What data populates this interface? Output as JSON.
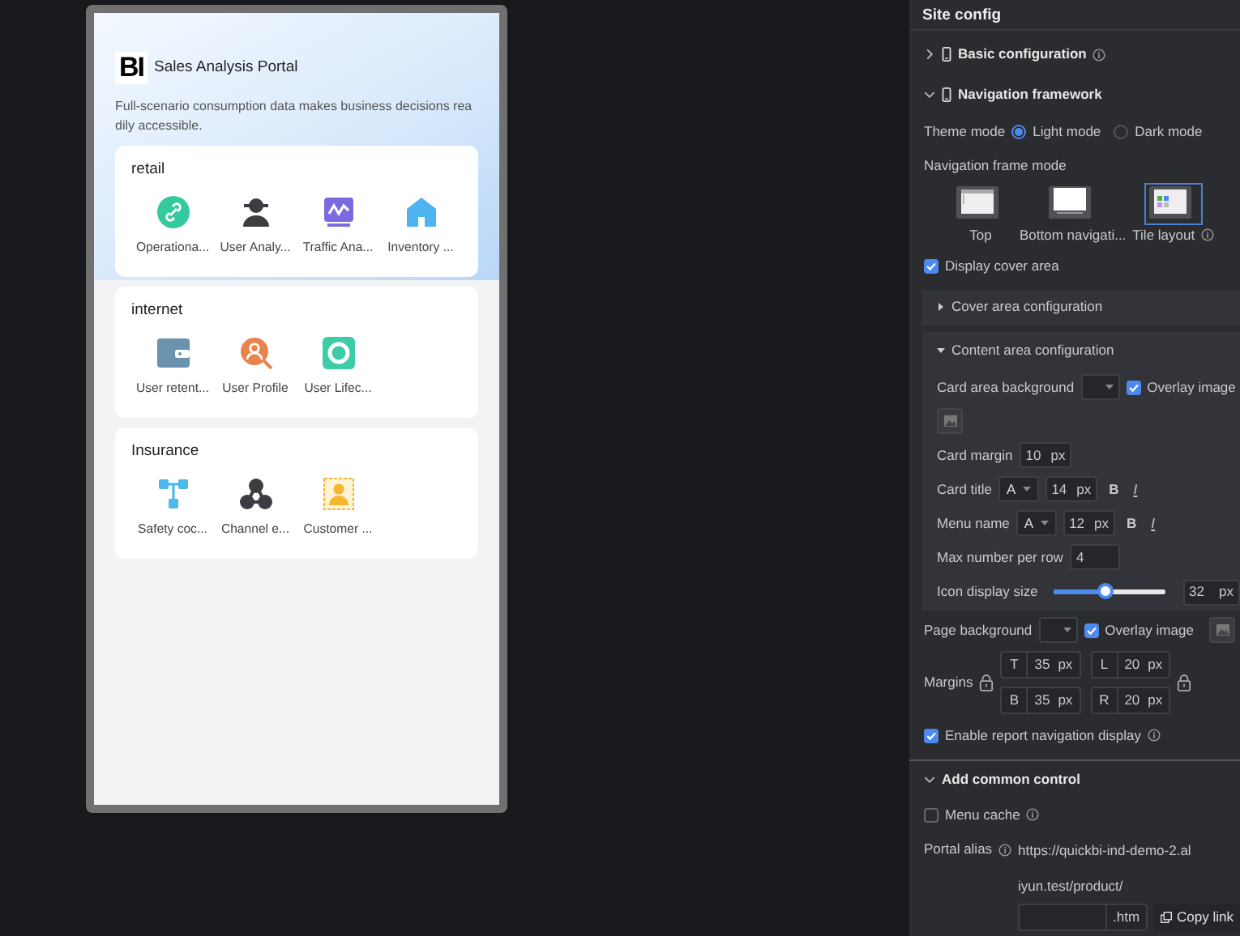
{
  "preview": {
    "logo": "BI",
    "title": "Sales Analysis Portal",
    "description": "Full-scenario consumption data makes business decisions readily accessible.",
    "groups": [
      {
        "title": "retail",
        "items": [
          {
            "label": "Operationa...",
            "kind": "link",
            "color": "#35c9a0"
          },
          {
            "label": "User Analy...",
            "kind": "user",
            "color": "#3b3d42"
          },
          {
            "label": "Traffic Ana...",
            "kind": "chart",
            "color": "#7b6be0"
          },
          {
            "label": "Inventory ...",
            "kind": "house",
            "color": "#4fb3f0"
          }
        ]
      },
      {
        "title": "internet",
        "items": [
          {
            "label": "User retent...",
            "kind": "wallet",
            "color": "#6b93ad"
          },
          {
            "label": "User Profile",
            "kind": "usersearch",
            "color": "#e8834e"
          },
          {
            "label": "User Lifec...",
            "kind": "ring",
            "color": "#3ecba8"
          }
        ]
      },
      {
        "title": "Insurance",
        "items": [
          {
            "label": "Safety coc...",
            "kind": "network",
            "color": "#4fb8ea"
          },
          {
            "label": "Channel e...",
            "kind": "nodes",
            "color": "#3b3d42"
          },
          {
            "label": "Customer ...",
            "kind": "contact",
            "color": "#f5b731"
          }
        ]
      }
    ]
  },
  "panel": {
    "title": "Site config",
    "basic": {
      "label": "Basic configuration",
      "expanded": false
    },
    "nav": {
      "label": "Navigation framework",
      "expanded": true,
      "theme": {
        "label": "Theme mode",
        "options": [
          {
            "label": "Light mode",
            "selected": true
          },
          {
            "label": "Dark mode",
            "selected": false
          }
        ]
      },
      "frame": {
        "label": "Navigation frame mode",
        "options": [
          {
            "label": "Top",
            "kind": "top",
            "selected": false
          },
          {
            "label": "Bottom navigati...",
            "kind": "bottom",
            "selected": false
          },
          {
            "label": "Tile layout",
            "kind": "tile",
            "selected": true
          }
        ]
      },
      "cover": {
        "label": "Display cover area",
        "checked": true
      },
      "cover_config": {
        "label": "Cover area configuration",
        "expanded": false
      },
      "content": {
        "label": "Content area configuration",
        "expanded": true,
        "card_bg": {
          "label": "Card area background",
          "overlay": {
            "label": "Overlay image",
            "checked": true
          }
        },
        "card_margin": {
          "label": "Card margin",
          "value": "10",
          "unit": "px"
        },
        "card_title": {
          "label": "Card title",
          "font": "A",
          "size": "14",
          "unit": "px",
          "bold": "B",
          "italic": "I"
        },
        "menu_name": {
          "label": "Menu name",
          "font": "A",
          "size": "12",
          "unit": "px",
          "bold": "B",
          "italic": "I"
        },
        "max_per_row": {
          "label": "Max number per row",
          "value": "4"
        },
        "icon_size": {
          "label": "Icon display size",
          "level": 0.47,
          "value": "32",
          "unit": "px"
        }
      },
      "page_bg": {
        "label": "Page background",
        "overlay": {
          "label": "Overlay image",
          "checked": true
        }
      },
      "margins": {
        "label": "Margins",
        "fields": [
          {
            "side": "T",
            "value": "35",
            "unit": "px"
          },
          {
            "side": "L",
            "value": "20",
            "unit": "px"
          },
          {
            "side": "B",
            "value": "35",
            "unit": "px"
          },
          {
            "side": "R",
            "value": "20",
            "unit": "px"
          }
        ]
      },
      "report_nav": {
        "label": "Enable report navigation display",
        "checked": true
      }
    },
    "common": {
      "label": "Add common control",
      "expanded": true,
      "menu_cache": {
        "label": "Menu cache",
        "checked": false
      },
      "portal_alias": {
        "label": "Portal alias",
        "url": "https://quickbi-ind-demo-2.aliyun.test/product/",
        "suffix": ".htm",
        "copy": "Copy link"
      }
    }
  }
}
